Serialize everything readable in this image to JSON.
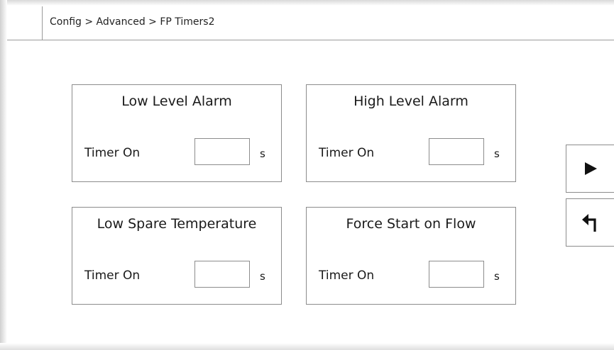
{
  "header": {
    "breadcrumb": "Config > Advanced > FP Timers2"
  },
  "panels": [
    {
      "title": "Low Level Alarm",
      "label": "Timer On",
      "value": "",
      "unit": "s"
    },
    {
      "title": "High Level Alarm",
      "label": "Timer On",
      "value": "",
      "unit": "s"
    },
    {
      "title": "Low Spare Temperature",
      "label": "Timer On",
      "value": "",
      "unit": "s"
    },
    {
      "title": "Force Start on Flow",
      "label": "Timer On",
      "value": "",
      "unit": "s"
    }
  ],
  "nav": {
    "next_icon": "play-arrow-icon",
    "back_icon": "return-arrow-icon"
  },
  "colors": {
    "border": "#8c8c8c",
    "text": "#1a1a1a",
    "background": "#ffffff"
  }
}
